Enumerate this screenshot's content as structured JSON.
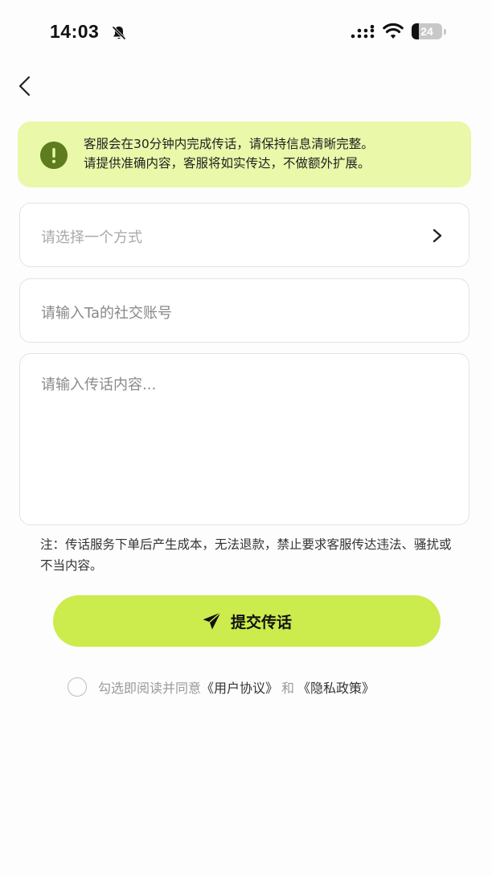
{
  "status_bar": {
    "time": "14:03",
    "battery_level": "24"
  },
  "notice": {
    "line1": "客服会在30分钟内完成传话，请保持信息清晰完整。",
    "line2": "请提供准确内容，客服将如实传达，不做额外扩展。",
    "icon": "exclamation-icon",
    "color": "#e9f8a9",
    "icon_color": "#5e7d1f"
  },
  "form": {
    "method_placeholder": "请选择一个方式",
    "account_placeholder": "请输入Ta的社交账号",
    "content_placeholder": "请输入传话内容..."
  },
  "note": "注：传话服务下单后产生成本，无法退款，禁止要求客服传达违法、骚扰或不当内容。",
  "submit": {
    "label": "提交传话",
    "icon": "send-icon",
    "color": "#cbec4c"
  },
  "agreement": {
    "prefix": "勾选即阅读并同意",
    "user_agreement": "《用户协议》",
    "conjunction": "和",
    "privacy_policy": "《隐私政策》",
    "checked": false
  }
}
